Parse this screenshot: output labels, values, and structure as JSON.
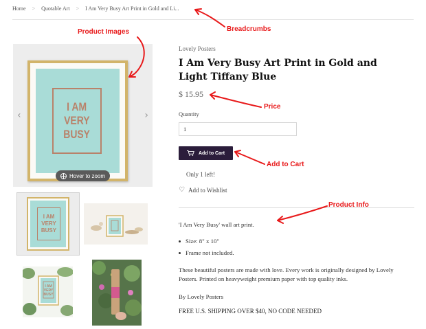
{
  "breadcrumb": {
    "items": [
      "Home",
      "Quotable Art",
      "I Am Very Busy Art Print in Gold and Li..."
    ],
    "separator": ">"
  },
  "annotations": {
    "breadcrumbs": "Breadcrumbs",
    "product_images": "Product Images",
    "price": "Price",
    "add_to_cart": "Add to Cart",
    "product_info": "Product Info",
    "color": "#e8191a"
  },
  "gallery": {
    "poster_lines": [
      "I AM",
      "VERY",
      "BUSY"
    ],
    "zoom_label": "Hover to zoom",
    "prev_icon": "chevron-left-icon",
    "next_icon": "chevron-right-icon"
  },
  "product": {
    "brand": "Lovely Posters",
    "title": "I Am Very Busy Art Print in Gold and Light Tiffany Blue",
    "price": "$ 15.95",
    "quantity_label": "Quantity",
    "quantity_value": "1",
    "add_to_cart_label": "Add to Cart",
    "stock_text": "Only 1 left!",
    "wishlist_label": "Add to Wishlist"
  },
  "description": {
    "intro": "'I Am Very Busy' wall art print.",
    "bullets": [
      "Size: 8\" x 10\"",
      "Frame not included."
    ],
    "body": "These beautiful posters are made with love. Every work is originally designed by Lovely Posters.  Printed on heavyweight premium paper with top quality inks.",
    "byline": "By Lovely Posters",
    "shipping": "FREE U.S. SHIPPING OVER $40, NO CODE NEEDED"
  },
  "colors": {
    "poster_blue": "#a9dcd7",
    "gold_frame": "#d2b46a",
    "copper_text": "#b9826a",
    "cart_button": "#2b1d3b",
    "annotation_red": "#e8191a"
  }
}
